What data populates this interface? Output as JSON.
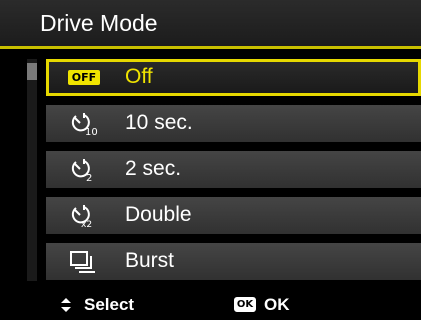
{
  "header": {
    "title": "Drive Mode"
  },
  "menu": {
    "items": [
      {
        "icon": "off-badge-icon",
        "badge": "OFF",
        "label": "Off",
        "selected": true
      },
      {
        "icon": "self-timer-10s-icon",
        "label": "10 sec.",
        "selected": false
      },
      {
        "icon": "self-timer-2s-icon",
        "label": "2 sec.",
        "selected": false
      },
      {
        "icon": "self-timer-double-icon",
        "label": "Double",
        "selected": false
      },
      {
        "icon": "burst-icon",
        "label": "Burst",
        "selected": false
      }
    ],
    "scroll_position": 0
  },
  "footer": {
    "select_label": "Select",
    "ok_badge": "OK",
    "ok_label": "OK"
  },
  "colors": {
    "accent": "#e6d800",
    "selected_text": "#f0e400",
    "item_background": "#3d3d3d",
    "header_rule": "#c9c000"
  }
}
